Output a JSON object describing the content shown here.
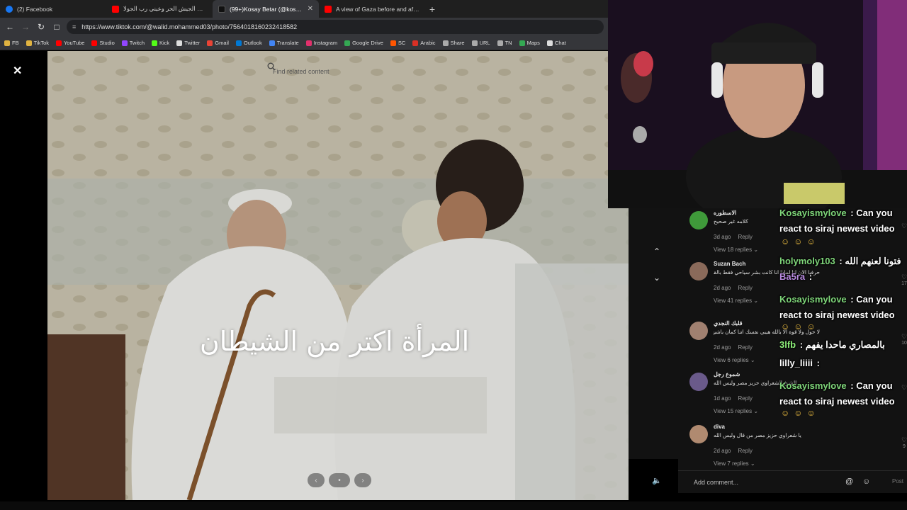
{
  "browser": {
    "tabs": [
      {
        "title": "(2) Facebook",
        "fav_color": "#1877f2",
        "active": false
      },
      {
        "title": "عيني رب الجيش الحر وعيني رب الجولا...",
        "fav_color": "#ff0000",
        "active": false
      },
      {
        "title": "(99+)Kosay Betar (@kosay.be...",
        "fav_color": "#222222",
        "active": true
      },
      {
        "title": "A view of Gaza before and after 7 Oc...",
        "fav_color": "#ff0000",
        "active": false
      }
    ],
    "close_glyph": "✕",
    "new_tab_glyph": "+",
    "url": "https://www.tiktok.com/@walid.mohammed03/photo/7564018160232418582",
    "bookmarks": [
      {
        "label": "FB",
        "color": "#e0b341"
      },
      {
        "label": "TikTok",
        "color": "#e0b341"
      },
      {
        "label": "YouTube",
        "color": "#ff0000"
      },
      {
        "label": "Studio",
        "color": "#ff0000"
      },
      {
        "label": "Twitch",
        "color": "#9146ff"
      },
      {
        "label": "Kick",
        "color": "#53fc18"
      },
      {
        "label": "Twitter",
        "color": "#dddddd"
      },
      {
        "label": "Gmail",
        "color": "#ea4335"
      },
      {
        "label": "Outlook",
        "color": "#0078d4"
      },
      {
        "label": "Translate",
        "color": "#4285f4"
      },
      {
        "label": "Instagram",
        "color": "#e1306c"
      },
      {
        "label": "Google Drive",
        "color": "#34a853"
      },
      {
        "label": "SC",
        "color": "#ff5500"
      },
      {
        "label": "Arabic",
        "color": "#d93025"
      },
      {
        "label": "Share",
        "color": "#aaaaaa"
      },
      {
        "label": "URL",
        "color": "#aaaaaa"
      },
      {
        "label": "TN",
        "color": "#aaaaaa"
      },
      {
        "label": "Maps",
        "color": "#34a853"
      },
      {
        "label": "Chat",
        "color": "#dddddd"
      }
    ]
  },
  "viewer": {
    "search_placeholder": "Find related content",
    "caption": "المرأة اكتر من الشيطان",
    "close_glyph": "✕",
    "prev_glyph": "‹",
    "next_glyph": "›"
  },
  "comments": [
    {
      "name": "الاسطوره",
      "text": "كلامه غير صحيح",
      "age": "3d ago",
      "reply": "Reply",
      "replies": "View 18 replies ⌄",
      "likes": "",
      "avatar_color": "#3f9a3a"
    },
    {
      "name": "Suzan Bach",
      "text": "حرفيا الان انا لماذا انا كانت بشر سياحي فقط بالقران وحتى القران لا يقبل القراءة بأبيات التفاسير المناصرة لحقوق المرأة",
      "age": "2d ago",
      "reply": "Reply",
      "replies": "View 41 replies ⌄",
      "likes": "17",
      "avatar_color": "#8a6a5a"
    },
    {
      "name": "قلبك النجدي",
      "text": "لا حول ولا قوة الا بالله هيبي نفسك اتنا كمان باشيخ",
      "age": "2d ago",
      "reply": "Reply",
      "replies": "View 6 replies ⌄",
      "likes": "10",
      "avatar_color": "#a08070"
    },
    {
      "name": "شموع رجل",
      "text": "الشيخ الشعراوي حزيز مصر وليس الله",
      "age": "1d ago",
      "reply": "Reply",
      "replies": "View 15 replies ⌄",
      "likes": "",
      "avatar_color": "#6a5a8a"
    },
    {
      "name": "diva",
      "text": "يا شعراوي حزيز مصر من قال وليس الله",
      "age": "2d ago",
      "reply": "Reply",
      "replies": "View 7 replies ⌄",
      "likes": "9",
      "avatar_color": "#b08a70"
    }
  ],
  "add_comment": {
    "placeholder": "Add comment...",
    "post": "Post"
  },
  "stream_chat": [
    {
      "user": "Kosayismylove",
      "msg": "Can you",
      "color": "#7fd67a"
    },
    {
      "user": "",
      "msg": "react to siraj newest video",
      "color": "#ffffff"
    },
    {
      "user": "holymoly103",
      "msg": "فتونا لعنهم الله",
      "color": "#7fd67a"
    },
    {
      "user": "Ba5ra",
      "msg": "",
      "color": "#b88ae0"
    },
    {
      "user": "Kosayismylove",
      "msg": "Can you",
      "color": "#7fd67a"
    },
    {
      "user": "",
      "msg": "react to siraj newest video",
      "color": "#ffffff"
    },
    {
      "user": "3lfb",
      "msg": "بالمصاري ماحدا يفهم",
      "color": "#8ef07a"
    },
    {
      "user": "lilly_liiii",
      "msg": "",
      "color": "#ffffff"
    },
    {
      "user": "Kosayismylove",
      "msg": "Can you",
      "color": "#7fd67a"
    },
    {
      "user": "",
      "msg": "react to siraj newest video",
      "color": "#ffffff"
    }
  ]
}
